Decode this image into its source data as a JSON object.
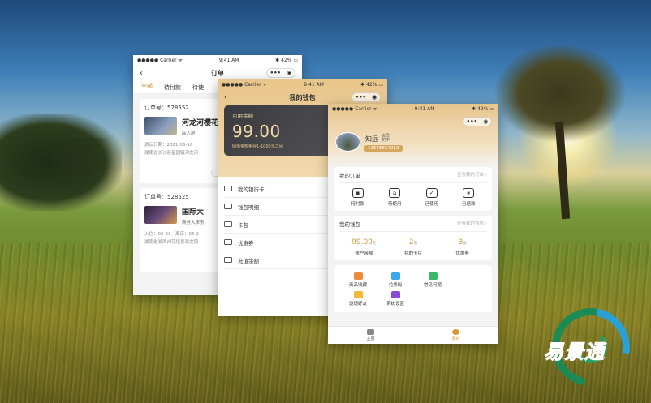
{
  "phone1": {
    "status": {
      "carrier": "●●●●● Carrier ᯤ",
      "time": "9:41 AM",
      "battery": "✱ 42% ▭"
    },
    "title": "订单",
    "tabs": [
      "全部",
      "待付款",
      "待使"
    ],
    "orders": [
      {
        "no": "订单号：528552",
        "hotel": "河龙河樱花",
        "room": "店人房",
        "date": "游玩日期：2021-06-16",
        "addr": "湖南省长沙县星园镇河龙河",
        "price": ""
      },
      {
        "no": "订单号：528525",
        "hotel": "国际大",
        "room": "商务大床房",
        "date": "入住：06-23　离店：06-2",
        "addr": "湖南省湖西州花垣县双龙镇",
        "price": "总"
      }
    ]
  },
  "phone2": {
    "status": {
      "carrier": "●●●●● Carrier ᯤ",
      "time": "9:41 AM",
      "battery": "✱ 42% ▭"
    },
    "title": "我的钱包",
    "balance_label": "可用余额",
    "balance": "99.00",
    "tip": "储值金额免谷1-1000元之间",
    "menu": [
      "我的银行卡",
      "钱包明细",
      "卡包",
      "优惠券",
      "充值余额"
    ]
  },
  "phone3": {
    "status": {
      "carrier": "●●●●● Carrier ᯤ",
      "time": "9:41 AM",
      "battery": "✱ 42% ▭"
    },
    "user": {
      "name": "知远",
      "tag": "会员 初中",
      "phone": "13545654213"
    },
    "orders_title": "我的订单",
    "orders_more": "查看我的订单 ›",
    "order_items": [
      {
        "icon": "wallet-icon",
        "glyph": "▣",
        "label": "待付款"
      },
      {
        "icon": "ticket-icon",
        "glyph": "⌂",
        "label": "待使用"
      },
      {
        "icon": "check-icon",
        "glyph": "✓",
        "label": "已使用"
      },
      {
        "icon": "yen-icon",
        "glyph": "¥",
        "label": "已退款"
      }
    ],
    "wallet_title": "我的钱包",
    "wallet_more": "查看我的钱包 ›",
    "wallet_items": [
      {
        "value": "99.00",
        "unit": "元",
        "label": "账户余额"
      },
      {
        "value": "2",
        "unit": "张",
        "label": "我的卡片"
      },
      {
        "value": "3",
        "unit": "张",
        "label": "优惠券"
      }
    ],
    "tools": [
      {
        "icon": "favorite-icon",
        "color": "#f08a3a",
        "label": "商品收藏"
      },
      {
        "icon": "exchange-icon",
        "color": "#3aa7e8",
        "label": "兑换码"
      },
      {
        "icon": "message-icon",
        "color": "#3ab86a",
        "label": "常见问题"
      },
      {
        "icon": "invite-icon",
        "color": "#f2b83a",
        "label": "邀请好友"
      },
      {
        "icon": "settings-icon",
        "color": "#8a4ad6",
        "label": "系统设置"
      }
    ],
    "tabbar": [
      {
        "label": "主页"
      },
      {
        "label": "我的"
      }
    ]
  },
  "logo": {
    "text": "易景通"
  }
}
